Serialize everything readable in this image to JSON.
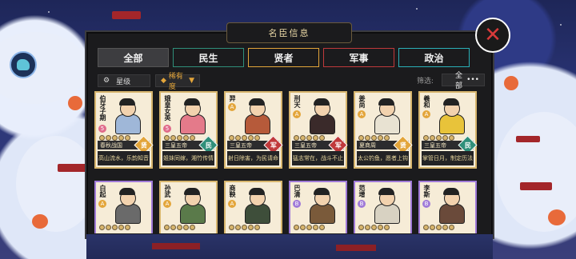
{
  "title": "名臣信息",
  "tabs": [
    {
      "label": "全部",
      "color": "#3d3d40",
      "text": "#f1f1f1"
    },
    {
      "label": "民生",
      "color": "#2f8f7a",
      "text": "#f1f1f1"
    },
    {
      "label": "贤者",
      "color": "#e3a53a",
      "text": "#f1f1f1"
    },
    {
      "label": "军事",
      "color": "#c0393b",
      "text": "#f1f1f1"
    },
    {
      "label": "政治",
      "color": "#2ab0b8",
      "text": "#f1f1f1"
    }
  ],
  "filters": {
    "star_label": "星级",
    "rarity_label": "稀有度",
    "filter_label": "筛选:",
    "filter_value": "全部",
    "more": "•••"
  },
  "cards": [
    {
      "name": "伯牙子期",
      "rank": "5",
      "rank_color": "#e06a8a",
      "bar": "春秋战国",
      "cat": "贤",
      "cat_color": "#e3a53a",
      "quote": "高山流水，乐韵知音",
      "border": "gold",
      "robe": "#9fb7d8"
    },
    {
      "name": "娥皇女英",
      "rank": "5",
      "rank_color": "#e06a8a",
      "bar": "三皇五帝",
      "cat": "民",
      "cat_color": "#2f8f7a",
      "quote": "姐妹同嫁，湘竹传情",
      "border": "gold",
      "robe": "#e47a8a"
    },
    {
      "name": "羿",
      "rank": "A",
      "rank_color": "#e3a53a",
      "bar": "三皇五帝",
      "cat": "军",
      "cat_color": "#c0393b",
      "quote": "射日除害，为民请命",
      "border": "gold",
      "robe": "#b65a3a"
    },
    {
      "name": "刑天",
      "rank": "A",
      "rank_color": "#e3a53a",
      "bar": "三皇五帝",
      "cat": "军",
      "cat_color": "#c0393b",
      "quote": "猛志常在，战斗不止",
      "border": "gold",
      "robe": "#3a2a2a"
    },
    {
      "name": "姜尚",
      "rank": "A",
      "rank_color": "#e3a53a",
      "bar": "夏商周",
      "cat": "贤",
      "cat_color": "#e3a53a",
      "quote": "太公钓鱼，愿者上钩",
      "border": "gold",
      "robe": "#e8e2d2"
    },
    {
      "name": "羲和",
      "rank": "A",
      "rank_color": "#e3a53a",
      "bar": "三皇五帝",
      "cat": "民",
      "cat_color": "#2f8f7a",
      "quote": "掌管日月，制定历法",
      "border": "gold",
      "robe": "#e8c33a"
    },
    {
      "name": "白起",
      "rank": "A",
      "rank_color": "#e3a53a",
      "bar": "",
      "cat": "",
      "cat_color": "",
      "quote": "",
      "border": "purple",
      "robe": "#6a6a6a"
    },
    {
      "name": "孙武",
      "rank": "A",
      "rank_color": "#e3a53a",
      "bar": "",
      "cat": "",
      "cat_color": "",
      "quote": "",
      "border": "gold",
      "robe": "#5a7a4a"
    },
    {
      "name": "商鞅",
      "rank": "A",
      "rank_color": "#e3a53a",
      "bar": "",
      "cat": "",
      "cat_color": "",
      "quote": "",
      "border": "gold",
      "robe": "#3e4e3a"
    },
    {
      "name": "巴清",
      "rank": "B",
      "rank_color": "#a07ad8",
      "bar": "",
      "cat": "",
      "cat_color": "",
      "quote": "",
      "border": "purple",
      "robe": "#7a5a3a"
    },
    {
      "name": "范增",
      "rank": "B",
      "rank_color": "#a07ad8",
      "bar": "",
      "cat": "",
      "cat_color": "",
      "quote": "",
      "border": "purple",
      "robe": "#d8d2c2"
    },
    {
      "name": "李斯",
      "rank": "B",
      "rank_color": "#a07ad8",
      "bar": "",
      "cat": "",
      "cat_color": "",
      "quote": "",
      "border": "purple",
      "robe": "#6a4a3a"
    }
  ],
  "colors": {
    "gold": "#d7b56d",
    "purple": "#a07ad8",
    "panel": "#1b1b1d"
  }
}
